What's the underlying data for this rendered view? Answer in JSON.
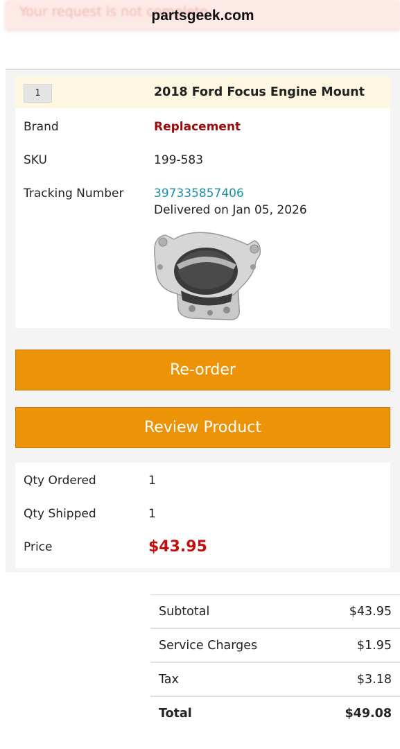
{
  "header": {
    "notice": "Your request is not complete",
    "site_title": "partsgeek.com"
  },
  "item": {
    "quantity_badge": "1",
    "title": "2018 Ford Focus Engine Mount",
    "brand_label": "Brand",
    "brand_value": "Replacement",
    "sku_label": "SKU",
    "sku_value": "199-583",
    "tracking_label": "Tracking Number",
    "tracking_number": "397335857406",
    "delivery_status": "Delivered on Jan 05, 2026",
    "image": "engine-mount-photo"
  },
  "actions": {
    "reorder_label": "Re-order",
    "review_label": "Review Product"
  },
  "quantities": {
    "qty_ordered_label": "Qty Ordered",
    "qty_ordered_value": "1",
    "qty_shipped_label": "Qty Shipped",
    "qty_shipped_value": "1",
    "price_label": "Price",
    "price_value": "$43.95"
  },
  "totals": {
    "rows": [
      {
        "label": "Subtotal",
        "value": "$43.95"
      },
      {
        "label": "Service Charges",
        "value": "$1.95"
      },
      {
        "label": "Tax",
        "value": "$3.18"
      },
      {
        "label": "Total",
        "value": "$49.08"
      }
    ]
  },
  "colors": {
    "button": "#ed9308",
    "brand": "#9b0d0d",
    "price": "#c40f0f",
    "link": "#1a8fa5",
    "header_band": "#fdf6e0"
  }
}
